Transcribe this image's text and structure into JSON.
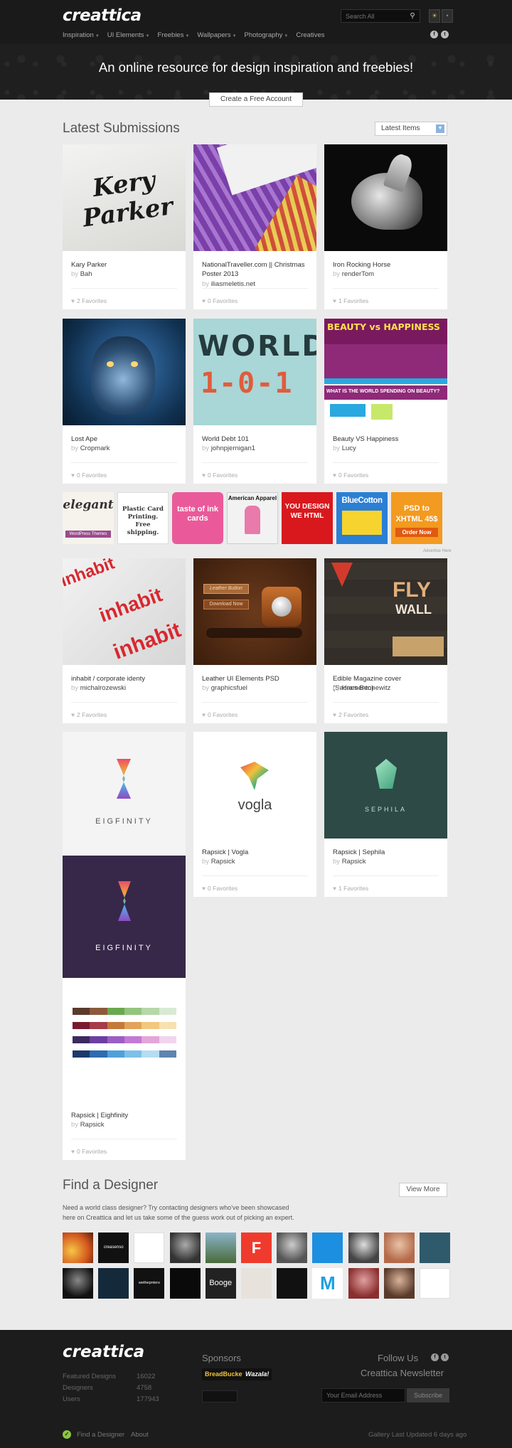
{
  "header": {
    "logo": "creattica",
    "search_placeholder": "Search All",
    "nav": [
      {
        "label": "Inspiration",
        "caret": true
      },
      {
        "label": "UI Elements",
        "caret": true
      },
      {
        "label": "Freebies",
        "caret": true
      },
      {
        "label": "Wallpapers",
        "caret": true
      },
      {
        "label": "Photography",
        "caret": true
      },
      {
        "label": "Creatives",
        "caret": false
      }
    ],
    "tagline": "An online resource for design inspiration and freebies!",
    "cta_label": "Create a Free Account"
  },
  "submissions": {
    "title": "Latest Submissions",
    "sort_value": "Latest Items",
    "by_word": "by",
    "cards": [
      {
        "title": "Kary Parker",
        "author": "Bah",
        "favorites": "2 Favorites",
        "art": "Kery Parker"
      },
      {
        "title": "NationalTraveller.com || Christmas Poster 2013",
        "author": "iliasmeletis.net",
        "favorites": "0 Favorites"
      },
      {
        "title": "Iron Rocking Horse",
        "author": "renderTom",
        "favorites": "1 Favorites"
      },
      {
        "title": "Lost Ape",
        "author": "Cropmark",
        "favorites": "0 Favorites"
      },
      {
        "title": "World Debt 101",
        "author": "johnpjernigan1",
        "favorites": "0 Favorites",
        "art_top": "WORLD",
        "art_bottom": "1-0-1"
      },
      {
        "title": "Beauty VS Happiness",
        "author": "Lucy",
        "favorites": "0 Favorites",
        "art_top": "BEAUTY vs HAPPINESS",
        "art_q": "WHAT IS THE WORLD SPENDING ON BEAUTY?"
      },
      {
        "title": "inhabit / corporate identy",
        "author": "michalrozewski",
        "favorites": "2 Favorites",
        "art": "inhabit"
      },
      {
        "title": "Leather UI Elements PSD",
        "author": "graphicsfuel",
        "favorites": "0 Favorites",
        "art_btn1": "Leather Button",
        "art_btn2": "Download Now"
      },
      {
        "title": "Edible Magazine cover (Sacramento)",
        "author": "Hans Bennewitz",
        "favorites": "2 Favorites",
        "art_fly": "FLY",
        "art_wall": "WALL"
      },
      {
        "title": "Rapsick | Eighfinity",
        "author": "Rapsick",
        "favorites": "0 Favorites",
        "art": "EIGFINITY"
      },
      {
        "title": "Rapsick | Vogla",
        "author": "Rapsick",
        "favorites": "0 Favorites",
        "art": "vogla"
      },
      {
        "title": "Rapsick | Sephila",
        "author": "Rapsick",
        "favorites": "1 Favorites",
        "art": "SEPHILA"
      }
    ]
  },
  "ads": [
    {
      "text": "elegant",
      "sub": "WordPress Themes"
    },
    {
      "text": "Plastic Card Printing. Free shipping."
    },
    {
      "text": "taste of ink cards"
    },
    {
      "text": "American Apparel"
    },
    {
      "text": "YOU DESIGN WE HTML"
    },
    {
      "text": "BlueCotton"
    },
    {
      "text": "PSD to XHTML 45$",
      "sub": "Order Now"
    }
  ],
  "ad_note": "Advertise Here",
  "find_designer": {
    "title": "Find a Designer",
    "text": "Need a world class designer? Try contacting designers who've been showcased here on Creattica and let us take some of the guess work out of picking an expert.",
    "view_more": "View More",
    "avatar_texts": [
      "",
      "creasenso",
      "",
      "",
      "",
      "F",
      "",
      "",
      "",
      "",
      "",
      "",
      "",
      "wethepnters",
      "",
      "Booge",
      "",
      "",
      "M",
      "",
      "",
      ""
    ]
  },
  "footer": {
    "logo": "creattica",
    "stats": [
      {
        "label": "Featured Designs",
        "value": "16022"
      },
      {
        "label": "Designers",
        "value": "4758"
      },
      {
        "label": "Users",
        "value": "177943"
      }
    ],
    "sponsors_label": "Sponsors",
    "sponsor1": "BreadBucket",
    "sponsor2": "Wazala!",
    "follow_label": "Follow Us",
    "newsletter_label": "Creattica Newsletter",
    "email_placeholder": "Your Email Address",
    "subscribe_label": "Subscribe",
    "link_find": "Find a Designer",
    "link_about": "About",
    "updated": "Gallery Last Updated 6 days ago"
  },
  "colors": {
    "page_bg": "#ebebeb",
    "header_bg": "#1f1f1f",
    "footer_bg": "#1c1c1c",
    "accent_green": "#8cc63f"
  }
}
